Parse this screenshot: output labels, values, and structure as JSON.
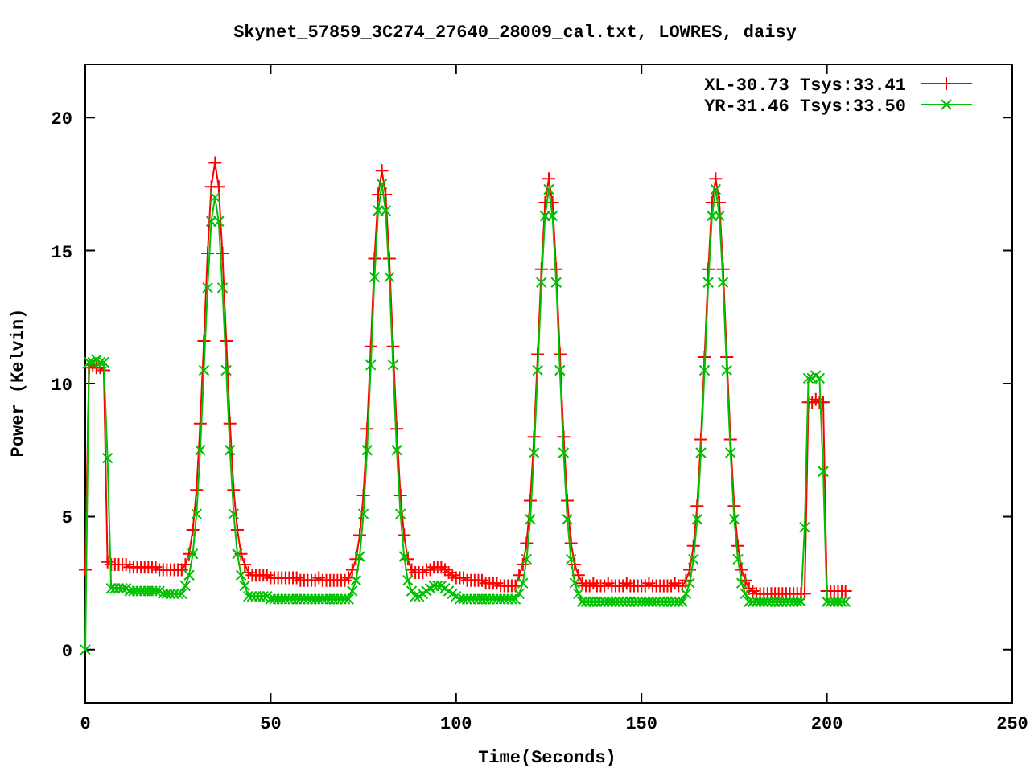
{
  "chart_data": {
    "type": "line",
    "legend": true,
    "title": "Skynet_57859_3C274_27640_28009_cal.txt, LOWRES, daisy",
    "xlabel": "Time(Seconds)",
    "ylabel": "Power (Kelvin)",
    "xlim": [
      0,
      250
    ],
    "ylim": [
      -2,
      22
    ],
    "xticks": [
      0,
      50,
      100,
      150,
      200,
      250
    ],
    "yticks": [
      0,
      5,
      10,
      15,
      20
    ],
    "x": [
      0,
      1,
      2,
      3,
      4,
      5,
      6,
      7,
      8,
      9,
      10,
      11,
      12,
      13,
      14,
      15,
      16,
      17,
      18,
      19,
      20,
      21,
      22,
      23,
      24,
      25,
      26,
      27,
      28,
      29,
      30,
      31,
      32,
      33,
      34,
      35,
      36,
      37,
      38,
      39,
      40,
      41,
      42,
      43,
      44,
      45,
      46,
      47,
      48,
      49,
      50,
      51,
      52,
      53,
      54,
      55,
      56,
      57,
      58,
      59,
      60,
      61,
      62,
      63,
      64,
      65,
      66,
      67,
      68,
      69,
      70,
      71,
      72,
      73,
      74,
      75,
      76,
      77,
      78,
      79,
      80,
      81,
      82,
      83,
      84,
      85,
      86,
      87,
      88,
      89,
      90,
      91,
      92,
      93,
      94,
      95,
      96,
      97,
      98,
      99,
      100,
      101,
      102,
      103,
      104,
      105,
      106,
      107,
      108,
      109,
      110,
      111,
      112,
      113,
      114,
      115,
      116,
      117,
      118,
      119,
      120,
      121,
      122,
      123,
      124,
      125,
      126,
      127,
      128,
      129,
      130,
      131,
      132,
      133,
      134,
      135,
      136,
      137,
      138,
      139,
      140,
      141,
      142,
      143,
      144,
      145,
      146,
      147,
      148,
      149,
      150,
      151,
      152,
      153,
      154,
      155,
      156,
      157,
      158,
      159,
      160,
      161,
      162,
      163,
      164,
      165,
      166,
      167,
      168,
      169,
      170,
      171,
      172,
      173,
      174,
      175,
      176,
      177,
      178,
      179,
      180,
      181,
      182,
      183,
      184,
      185,
      186,
      187,
      188,
      189,
      190,
      191,
      192,
      193,
      194,
      195,
      196,
      197,
      198,
      199,
      200,
      201,
      202,
      203,
      204,
      205
    ],
    "series": [
      {
        "name": "XL-30.73 Tsys:33.41",
        "color": "#ff0000",
        "marker": "plus",
        "values": [
          3.0,
          10.6,
          10.7,
          10.6,
          10.6,
          10.5,
          3.3,
          3.2,
          3.2,
          3.2,
          3.2,
          3.2,
          3.1,
          3.1,
          3.1,
          3.1,
          3.1,
          3.1,
          3.1,
          3.1,
          3.0,
          3.0,
          3.0,
          3.0,
          3.0,
          3.0,
          3.0,
          3.2,
          3.6,
          4.5,
          6.0,
          8.5,
          11.6,
          14.9,
          17.4,
          18.3,
          17.4,
          14.9,
          11.6,
          8.5,
          6.0,
          4.5,
          3.6,
          3.2,
          2.9,
          2.8,
          2.8,
          2.8,
          2.8,
          2.8,
          2.7,
          2.7,
          2.7,
          2.7,
          2.7,
          2.7,
          2.7,
          2.7,
          2.6,
          2.6,
          2.6,
          2.6,
          2.6,
          2.7,
          2.6,
          2.6,
          2.6,
          2.6,
          2.6,
          2.6,
          2.6,
          2.7,
          3.0,
          3.4,
          4.3,
          5.8,
          8.3,
          11.4,
          14.7,
          17.1,
          18.0,
          17.1,
          14.7,
          11.4,
          8.3,
          5.8,
          4.3,
          3.4,
          3.0,
          2.9,
          2.9,
          2.9,
          3.0,
          3.0,
          3.1,
          3.1,
          3.1,
          3.0,
          2.9,
          2.8,
          2.7,
          2.7,
          2.7,
          2.6,
          2.6,
          2.6,
          2.6,
          2.6,
          2.5,
          2.5,
          2.5,
          2.5,
          2.4,
          2.4,
          2.4,
          2.4,
          2.4,
          2.8,
          3.2,
          4.0,
          5.6,
          8.0,
          11.1,
          14.3,
          16.8,
          17.7,
          16.8,
          14.3,
          11.1,
          8.0,
          5.6,
          4.0,
          3.2,
          2.8,
          2.5,
          2.4,
          2.4,
          2.5,
          2.4,
          2.4,
          2.4,
          2.5,
          2.4,
          2.4,
          2.4,
          2.4,
          2.5,
          2.4,
          2.4,
          2.4,
          2.4,
          2.4,
          2.5,
          2.4,
          2.4,
          2.4,
          2.4,
          2.4,
          2.4,
          2.5,
          2.4,
          2.4,
          2.6,
          3.0,
          3.9,
          5.4,
          7.9,
          11.0,
          14.3,
          16.8,
          17.7,
          16.8,
          14.3,
          11.0,
          7.9,
          5.4,
          3.9,
          3.0,
          2.6,
          2.3,
          2.2,
          2.1,
          2.1,
          2.1,
          2.1,
          2.1,
          2.1,
          2.1,
          2.1,
          2.1,
          2.1,
          2.1,
          2.1,
          2.1,
          2.1,
          9.3,
          9.3,
          9.4,
          9.3,
          9.3,
          2.2,
          2.2,
          2.2,
          2.2,
          2.2,
          2.2
        ]
      },
      {
        "name": "YR-31.46 Tsys:33.50",
        "color": "#00c000",
        "marker": "cross",
        "values": [
          0.0,
          10.8,
          10.8,
          10.9,
          10.8,
          10.8,
          7.2,
          2.3,
          2.3,
          2.3,
          2.3,
          2.3,
          2.2,
          2.2,
          2.2,
          2.2,
          2.2,
          2.2,
          2.2,
          2.2,
          2.2,
          2.1,
          2.1,
          2.1,
          2.1,
          2.1,
          2.1,
          2.4,
          2.8,
          3.6,
          5.1,
          7.5,
          10.5,
          13.6,
          16.1,
          17.0,
          16.1,
          13.6,
          10.5,
          7.5,
          5.1,
          3.6,
          2.8,
          2.4,
          2.0,
          2.0,
          2.0,
          2.0,
          2.0,
          2.0,
          1.9,
          1.9,
          1.9,
          1.9,
          1.9,
          1.9,
          1.9,
          1.9,
          1.9,
          1.9,
          1.9,
          1.9,
          1.9,
          1.9,
          1.9,
          1.9,
          1.9,
          1.9,
          1.9,
          1.9,
          1.9,
          1.9,
          2.2,
          2.6,
          3.5,
          5.1,
          7.5,
          10.7,
          14.0,
          16.5,
          17.5,
          16.5,
          14.0,
          10.7,
          7.5,
          5.1,
          3.5,
          2.6,
          2.2,
          2.0,
          2.0,
          2.1,
          2.2,
          2.3,
          2.4,
          2.4,
          2.4,
          2.3,
          2.2,
          2.1,
          2.0,
          1.9,
          1.9,
          1.9,
          1.9,
          1.9,
          1.9,
          1.9,
          1.9,
          1.9,
          1.9,
          1.9,
          1.9,
          1.9,
          1.9,
          1.9,
          1.9,
          2.1,
          2.5,
          3.4,
          4.9,
          7.4,
          10.5,
          13.8,
          16.3,
          17.3,
          16.3,
          13.8,
          10.5,
          7.4,
          4.9,
          3.4,
          2.5,
          2.1,
          1.8,
          1.8,
          1.8,
          1.8,
          1.8,
          1.8,
          1.8,
          1.8,
          1.8,
          1.8,
          1.8,
          1.8,
          1.8,
          1.8,
          1.8,
          1.8,
          1.8,
          1.8,
          1.8,
          1.8,
          1.8,
          1.8,
          1.8,
          1.8,
          1.8,
          1.8,
          1.8,
          1.8,
          2.1,
          2.5,
          3.4,
          4.9,
          7.4,
          10.5,
          13.8,
          16.3,
          17.3,
          16.3,
          13.8,
          10.5,
          7.4,
          4.9,
          3.4,
          2.5,
          2.1,
          1.8,
          1.8,
          1.8,
          1.8,
          1.8,
          1.8,
          1.8,
          1.8,
          1.8,
          1.8,
          1.8,
          1.8,
          1.8,
          1.8,
          1.8,
          4.6,
          10.2,
          10.2,
          10.3,
          10.2,
          6.7,
          1.8,
          1.8,
          1.8,
          1.8,
          1.8,
          1.8
        ]
      }
    ]
  }
}
